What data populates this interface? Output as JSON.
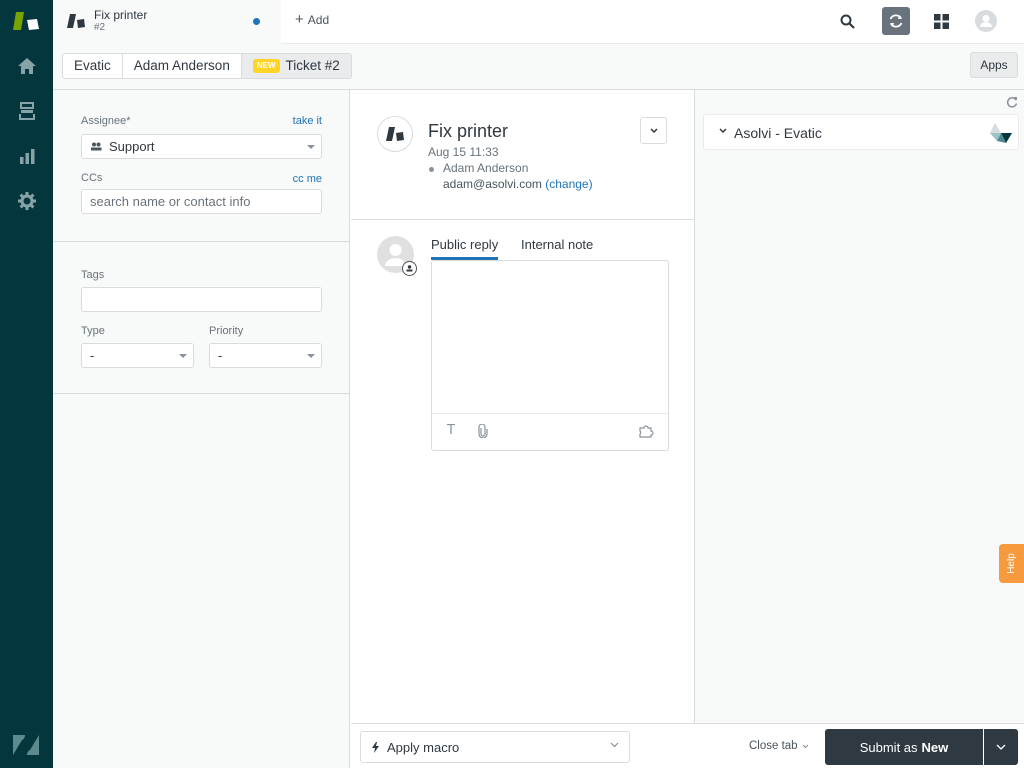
{
  "nav": {
    "items": [
      {
        "name": "home",
        "icon": "home-icon"
      },
      {
        "name": "views",
        "icon": "views-icon"
      },
      {
        "name": "reporting",
        "icon": "bar-chart-icon"
      },
      {
        "name": "admin",
        "icon": "gear-icon"
      }
    ]
  },
  "topbar": {
    "tab_title": "Fix printer",
    "tab_subtitle": "#2",
    "add_label": "Add",
    "add_icon": "+"
  },
  "breadcrumb": {
    "items": [
      "Evatic",
      "Adam Anderson",
      "Ticket #2"
    ],
    "status_badge": "NEW",
    "apps_label": "Apps"
  },
  "properties": {
    "assignee_label": "Assignee*",
    "take_it": "take it",
    "assignee_value": "Support",
    "ccs_label": "CCs",
    "cc_me": "cc me",
    "ccs_placeholder": "search name or contact info",
    "tags_label": "Tags",
    "tags_value": "",
    "type_label": "Type",
    "type_value": "-",
    "priority_label": "Priority",
    "priority_value": "-"
  },
  "ticket": {
    "subject": "Fix printer",
    "date": "Aug 15 11:33",
    "requester": "Adam Anderson",
    "email": "adam@asolvi.com",
    "change": "(change)"
  },
  "reply": {
    "tabs": [
      {
        "label": "Public reply",
        "active": true
      },
      {
        "label": "Internal note",
        "active": false
      }
    ],
    "text_icon": "T"
  },
  "apps_panel": {
    "app_name": "Asolvi - Evatic"
  },
  "bottom": {
    "macro_label": "Apply macro",
    "close_tab_label": "Close tab",
    "submit_prefix": "Submit as",
    "submit_status": "New"
  },
  "help": {
    "label": "Help"
  },
  "colors": {
    "nav_bg": "#03363d",
    "accent": "#1f73b7",
    "new_badge": "#ffd424",
    "submit_bg": "#2f3941",
    "help_bg": "#f79a3e"
  }
}
